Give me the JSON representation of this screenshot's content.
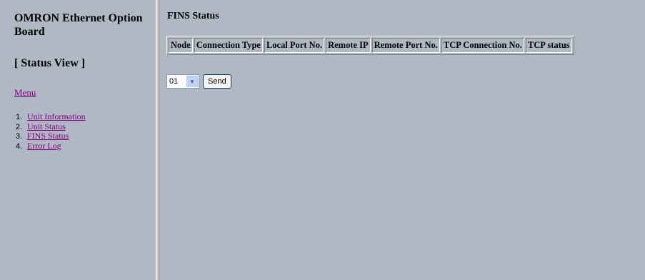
{
  "sidebar": {
    "brand": "OMRON Ethernet Option Board",
    "view_label": "[ Status View ]",
    "menu_label": "Menu",
    "items": [
      {
        "num": "1.",
        "label": "Unit Information"
      },
      {
        "num": "2.",
        "label": "Unit Status"
      },
      {
        "num": "3.",
        "label": "FINS Status"
      },
      {
        "num": "4.",
        "label": "Error Log"
      }
    ]
  },
  "main": {
    "title": "FINS Status",
    "table": {
      "headers": [
        "Node",
        "Connection Type",
        "Local Port No.",
        "Remote IP",
        "Remote Port No.",
        "TCP Connection No.",
        "TCP status"
      ]
    },
    "node_select": {
      "selected": "01",
      "arrow": "▼"
    },
    "send_label": "Send"
  }
}
